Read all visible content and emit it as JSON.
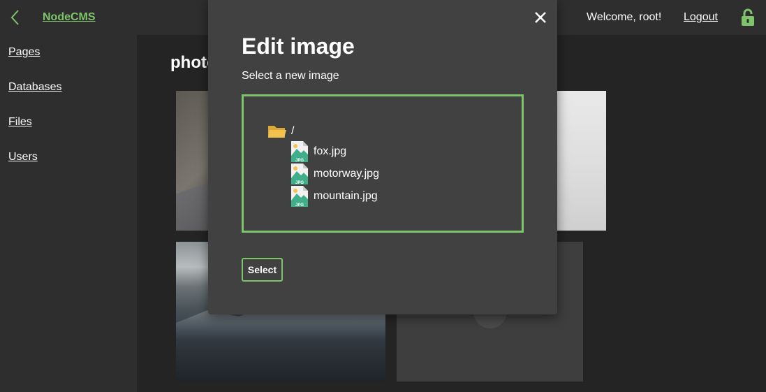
{
  "header": {
    "brand": "NodeCMS",
    "welcome": "Welcome, root!",
    "logout": "Logout"
  },
  "sidebar": {
    "items": [
      {
        "label": "Pages"
      },
      {
        "label": "Databases"
      },
      {
        "label": "Files"
      },
      {
        "label": "Users"
      }
    ]
  },
  "main": {
    "heading": "photo"
  },
  "modal": {
    "title": "Edit image",
    "subtitle": "Select a new image",
    "tree": {
      "root": "/",
      "files": [
        "fox.jpg",
        "motorway.jpg",
        "mountain.jpg"
      ]
    },
    "select_label": "Select"
  },
  "colors": {
    "accent": "#7dc46a",
    "background": "#2e2e2e",
    "main_background": "#242424",
    "modal_background": "#414141",
    "folder": "#f2c14e"
  },
  "icons": [
    "back-chevron-icon",
    "lock-open-icon",
    "close-icon",
    "folder-open-icon",
    "jpg-file-icon",
    "plus-icon"
  ]
}
